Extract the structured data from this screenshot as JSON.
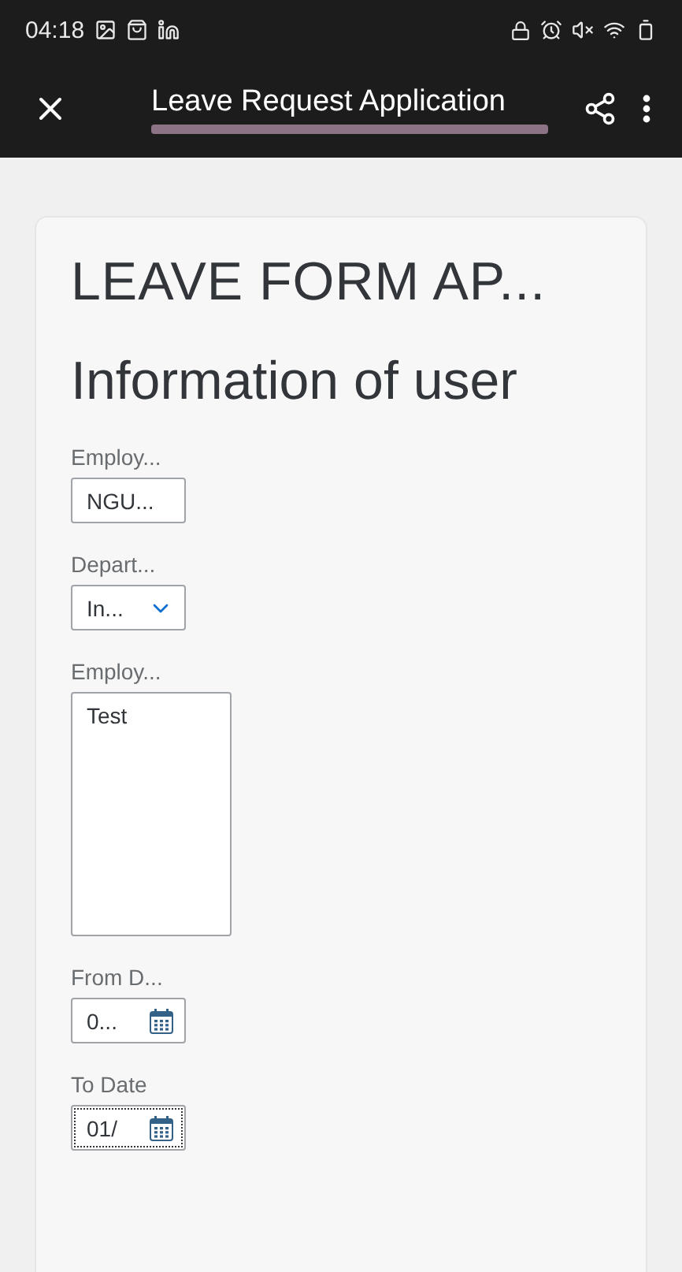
{
  "status_bar": {
    "time": "04:18"
  },
  "app_bar": {
    "title": "Leave Request Application",
    "url_redacted": true
  },
  "form": {
    "title": "LEAVE FORM AP...",
    "section": "Information of user",
    "fields": [
      {
        "kind": "text",
        "label": "Employ...",
        "value": "NGU...",
        "focused": false
      },
      {
        "kind": "select",
        "label": "Depart...",
        "value": "In...",
        "focused": false
      },
      {
        "kind": "textarea",
        "label": "Employ...",
        "value": "Test",
        "focused": false
      },
      {
        "kind": "date",
        "label": "From D...",
        "value": "0...",
        "focused": false
      },
      {
        "kind": "date",
        "label": "To Date",
        "value": "01/",
        "focused": true
      }
    ]
  }
}
